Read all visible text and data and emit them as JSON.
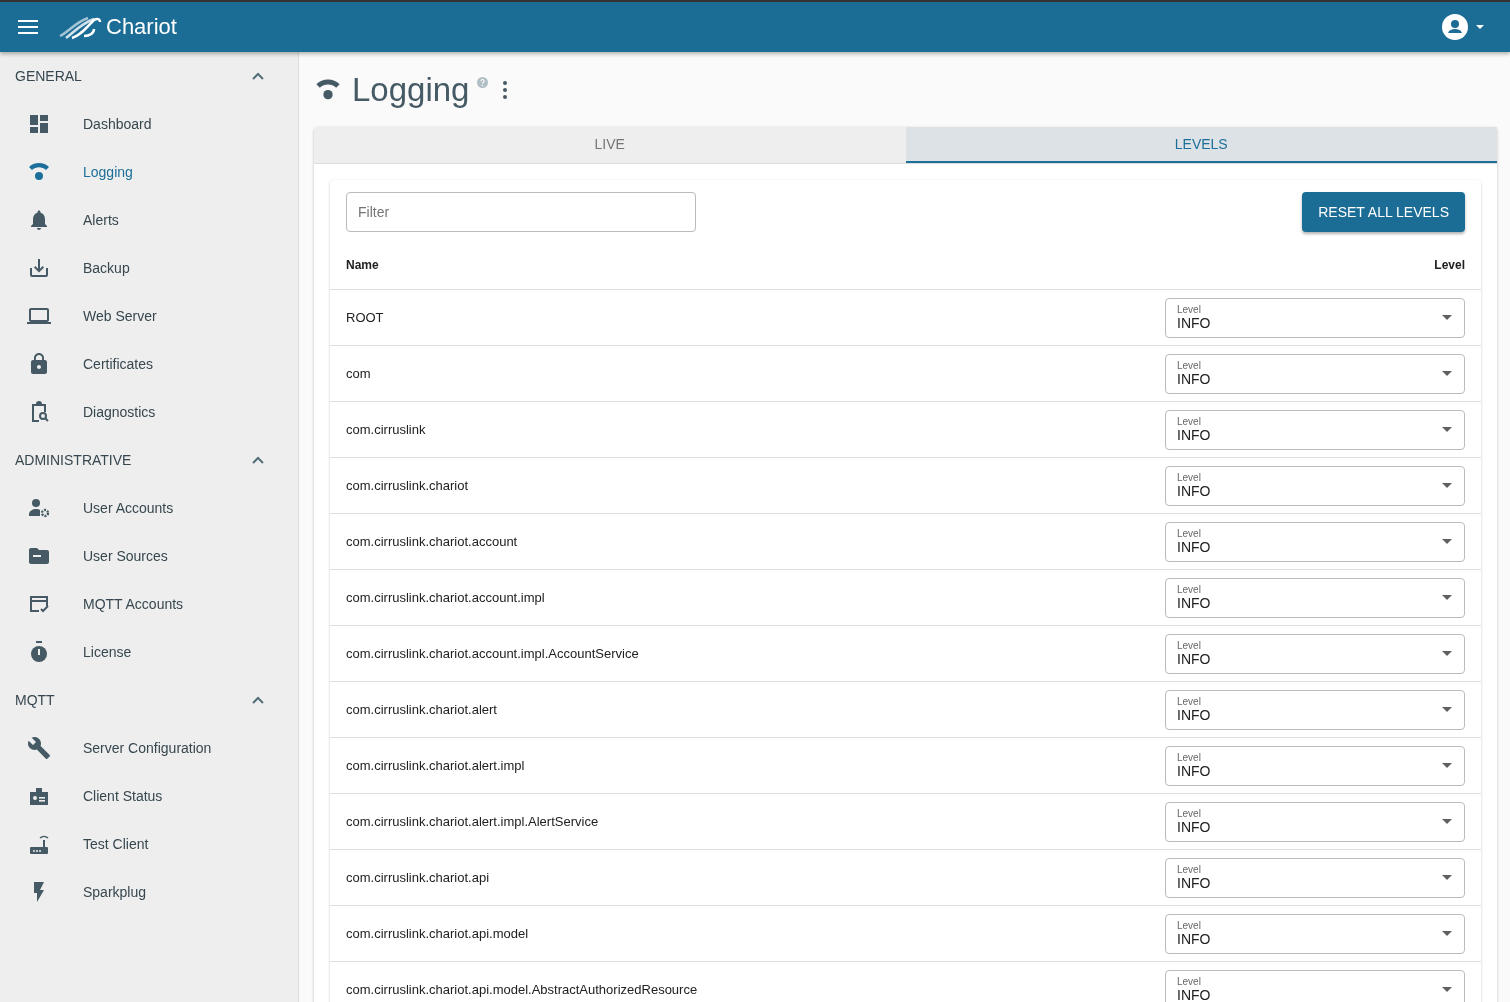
{
  "app_bar": {
    "title": "Chariot"
  },
  "sidebar": {
    "sections": [
      {
        "title": "GENERAL",
        "expanded": true,
        "items": [
          {
            "label": "Dashboard",
            "selected": false
          },
          {
            "label": "Logging",
            "selected": true
          },
          {
            "label": "Alerts",
            "selected": false
          },
          {
            "label": "Backup",
            "selected": false
          },
          {
            "label": "Web Server",
            "selected": false
          },
          {
            "label": "Certificates",
            "selected": false
          },
          {
            "label": "Diagnostics",
            "selected": false
          }
        ]
      },
      {
        "title": "ADMINISTRATIVE",
        "expanded": true,
        "items": [
          {
            "label": "User Accounts",
            "selected": false
          },
          {
            "label": "User Sources",
            "selected": false
          },
          {
            "label": "MQTT Accounts",
            "selected": false
          },
          {
            "label": "License",
            "selected": false
          }
        ]
      },
      {
        "title": "MQTT",
        "expanded": true,
        "items": [
          {
            "label": "Server Configuration",
            "selected": false
          },
          {
            "label": "Client Status",
            "selected": false
          },
          {
            "label": "Test Client",
            "selected": false
          },
          {
            "label": "Sparkplug",
            "selected": false
          }
        ]
      }
    ]
  },
  "page": {
    "title": "Logging"
  },
  "tabs": [
    {
      "label": "LIVE",
      "selected": false
    },
    {
      "label": "LEVELS",
      "selected": true
    }
  ],
  "filter": {
    "placeholder": "Filter"
  },
  "reset_button": "RESET ALL LEVELS",
  "table": {
    "columns": [
      "Name",
      "Level"
    ],
    "rows": [
      {
        "name": "ROOT",
        "field_label": "Level",
        "value": "INFO"
      },
      {
        "name": "com",
        "field_label": "Level",
        "value": "INFO"
      },
      {
        "name": "com.cirruslink",
        "field_label": "Level",
        "value": "INFO"
      },
      {
        "name": "com.cirruslink.chariot",
        "field_label": "Level",
        "value": "INFO"
      },
      {
        "name": "com.cirruslink.chariot.account",
        "field_label": "Level",
        "value": "INFO"
      },
      {
        "name": "com.cirruslink.chariot.account.impl",
        "field_label": "Level",
        "value": "INFO"
      },
      {
        "name": "com.cirruslink.chariot.account.impl.AccountService",
        "field_label": "Level",
        "value": "INFO"
      },
      {
        "name": "com.cirruslink.chariot.alert",
        "field_label": "Level",
        "value": "INFO"
      },
      {
        "name": "com.cirruslink.chariot.alert.impl",
        "field_label": "Level",
        "value": "INFO"
      },
      {
        "name": "com.cirruslink.chariot.alert.impl.AlertService",
        "field_label": "Level",
        "value": "INFO"
      },
      {
        "name": "com.cirruslink.chariot.api",
        "field_label": "Level",
        "value": "INFO"
      },
      {
        "name": "com.cirruslink.chariot.api.model",
        "field_label": "Level",
        "value": "INFO"
      },
      {
        "name": "com.cirruslink.chariot.api.model.AbstractAuthorizedResource",
        "field_label": "Level",
        "value": "INFO"
      }
    ]
  }
}
